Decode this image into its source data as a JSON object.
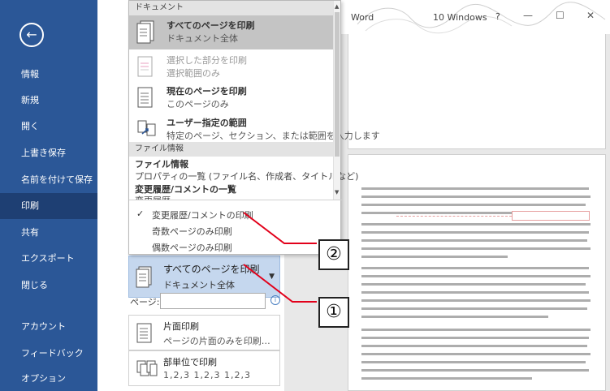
{
  "window": {
    "app_title": "Word",
    "user_name": "10 Windows",
    "help": "?",
    "minimize": "—",
    "maximize": "☐",
    "close": "✕"
  },
  "sidebar": {
    "back": "←",
    "items": [
      {
        "label": "情報"
      },
      {
        "label": "新規"
      },
      {
        "label": "開く"
      },
      {
        "label": "上書き保存"
      },
      {
        "label": "名前を付けて保存"
      },
      {
        "label": "印刷",
        "active": true
      },
      {
        "label": "共有"
      },
      {
        "label": "エクスポート"
      },
      {
        "label": "閉じる"
      },
      {
        "label": "アカウント"
      },
      {
        "label": "フィードバック"
      },
      {
        "label": "オプション"
      }
    ]
  },
  "dropdown": {
    "section_document": "ドキュメント",
    "items": [
      {
        "title": "すべてのページを印刷",
        "sub": "ドキュメント全体",
        "selected": true
      },
      {
        "title": "選択した部分を印刷",
        "sub": "選択範囲のみ",
        "disabled": true
      },
      {
        "title": "現在のページを印刷",
        "sub": "このページのみ"
      },
      {
        "title": "ユーザー指定の範囲",
        "sub": "特定のページ、セクション、または範囲を入力します"
      }
    ],
    "section_file_info": "ファイル情報",
    "file_info_title": "ファイル情報",
    "file_info_sub": "プロパティの一覧 (ファイル名、作成者、タイトルなど)",
    "markup_title": "変更履歴/コメントの一覧",
    "markup_sub": "変更履歴",
    "options": [
      {
        "label": "変更履歴/コメントの印刷",
        "checked": true
      },
      {
        "label": "奇数ページのみ印刷"
      },
      {
        "label": "偶数ページのみ印刷"
      }
    ],
    "check": "✓"
  },
  "settings": {
    "print_what_title": "すべてのページを印刷",
    "print_what_sub": "ドキュメント全体",
    "pages_label": "ページ:",
    "pages_value": "",
    "info": "i",
    "sides_title": "片面印刷",
    "sides_sub": "ページの片面のみを印刷…",
    "collate_title": "部単位で印刷",
    "collate_sub": "1,2,3   1,2,3   1,2,3"
  },
  "callouts": {
    "one": "①",
    "two": "②"
  },
  "colors": {
    "sidebar": "#2b5797",
    "sidebar_active": "#1e3f73",
    "selected_setting": "#c5d7ee",
    "dropdown_selected": "#c4c4c4",
    "comment_markup": "#e6a0a0"
  }
}
